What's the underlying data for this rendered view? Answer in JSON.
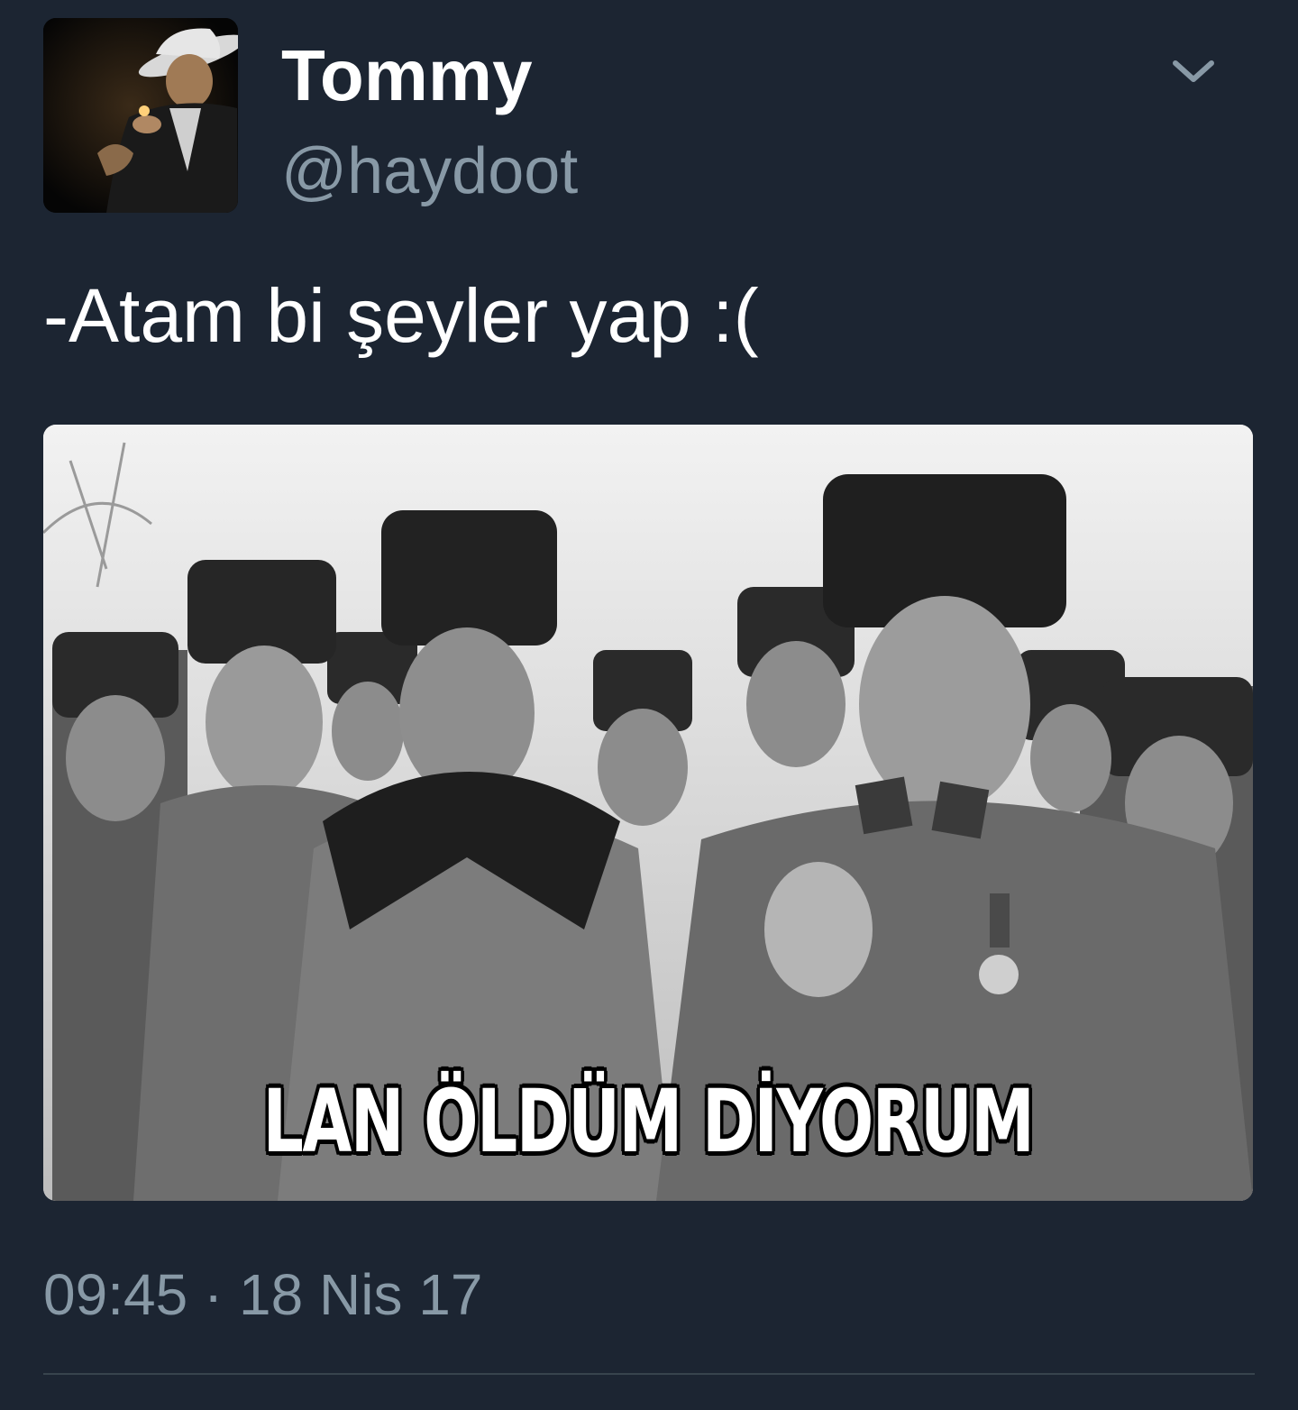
{
  "tweet": {
    "author": {
      "display_name": "Tommy",
      "handle": "@haydoot",
      "avatar_icon": "man-in-fedora-avatar"
    },
    "menu_icon": "chevron-down-icon",
    "text": "-Atam bi şeyler yap :(",
    "media": {
      "description_icon": "black-and-white-photo-of-men-in-fur-hats",
      "caption": "LAN ÖLDÜM DİYORUM"
    },
    "time": "09:45",
    "separator": "·",
    "date": "18 Nis 17"
  },
  "colors": {
    "background": "#1c2532",
    "primary_text": "#ffffff",
    "secondary_text": "#8899a6",
    "divider": "#38444d"
  }
}
